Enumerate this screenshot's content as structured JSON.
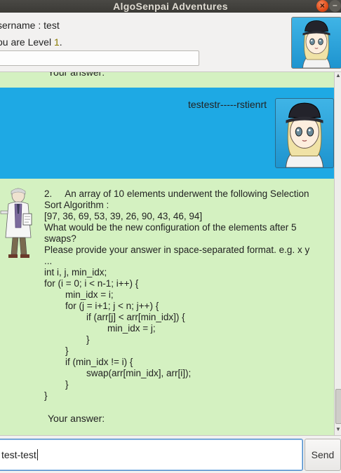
{
  "window": {
    "title": "AlgoSenpai Adventures",
    "close_glyph": "×",
    "minimize_glyph": "–"
  },
  "header": {
    "username_text": "sername : test",
    "level_prefix": "ou are Level ",
    "level_number": "1",
    "level_suffix": ".",
    "progress_fraction": 0
  },
  "dialog": {
    "prev_answer_label": "Your answer:",
    "user_message": "testestr-----rstienrt",
    "bot_message": "2.     An array of 10 elements underwent the following Selection\nSort Algorithm :\n[97, 36, 69, 53, 39, 26, 90, 43, 46, 94]\nWhat would be the new configuration of the elements after 5\nswaps?\nPlease provide your answer in space-separated format. e.g. x y\n...\nint i, j, min_idx;\nfor (i = 0; i < n-1; i++) {\n        min_idx = i;\n        for (j = i+1; j < n; j++) {\n                if (arr[j] < arr[min_idx]) {\n                        min_idx = j;\n                }\n        }\n        if (min_idx != i) {\n                swap(arr[min_idx], arr[i]);\n        }\n}",
    "bot_answer_label": "Your answer:"
  },
  "footer": {
    "input_value": "test-test",
    "send_label": "Send"
  },
  "icons": {
    "user_avatar": "user-avatar-icon",
    "bot_avatar": "professor-icon"
  },
  "colors": {
    "dialog_bg": "#d4f1c1",
    "user_row_bg": "#1ea9e4"
  }
}
